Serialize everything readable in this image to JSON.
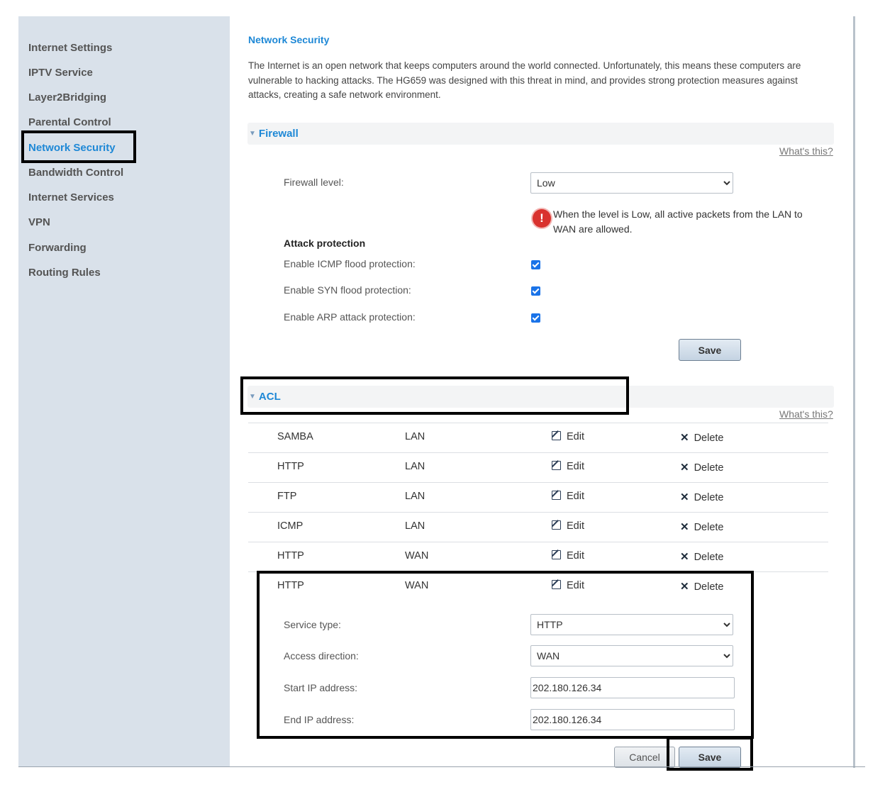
{
  "sidebar": {
    "items": [
      {
        "label": "Internet Settings"
      },
      {
        "label": "IPTV Service"
      },
      {
        "label": "Layer2Bridging"
      },
      {
        "label": "Parental Control"
      },
      {
        "label": "Network Security"
      },
      {
        "label": "Bandwidth Control"
      },
      {
        "label": "Internet Services"
      },
      {
        "label": "VPN"
      },
      {
        "label": "Forwarding"
      },
      {
        "label": "Routing Rules"
      }
    ],
    "active": "Network Security"
  },
  "main": {
    "title": "Network Security",
    "intro": "The Internet is an open network that keeps computers around the world connected. Unfortunately, this means these computers are vulnerable to hacking attacks. The HG659 was designed with this threat in mind, and provides strong protection measures against attacks, creating a safe network environment."
  },
  "firewall": {
    "section_title": "Firewall",
    "whats_this": "What's this?",
    "level_label": "Firewall level:",
    "level_value": "Low",
    "level_options": [
      "Low"
    ],
    "warning": "When the level is Low, all active packets from the LAN to WAN are allowed.",
    "attack_title": "Attack protection",
    "icmp_label": "Enable ICMP flood protection:",
    "syn_label": "Enable SYN flood protection:",
    "arp_label": "Enable ARP attack protection:",
    "icmp_checked": true,
    "syn_checked": true,
    "arp_checked": true,
    "save_label": "Save"
  },
  "acl": {
    "section_title": "ACL",
    "whats_this": "What's this?",
    "edit_label": "Edit",
    "delete_label": "Delete",
    "rows": [
      {
        "service": "SAMBA",
        "direction": "LAN"
      },
      {
        "service": "HTTP",
        "direction": "LAN"
      },
      {
        "service": "FTP",
        "direction": "LAN"
      },
      {
        "service": "ICMP",
        "direction": "LAN"
      },
      {
        "service": "HTTP",
        "direction": "WAN"
      },
      {
        "service": "HTTP",
        "direction": "WAN"
      }
    ],
    "form": {
      "service_type_label": "Service type:",
      "service_type_value": "HTTP",
      "access_direction_label": "Access direction:",
      "access_direction_value": "WAN",
      "start_ip_label": "Start IP address:",
      "start_ip_value": "202.180.126.34",
      "end_ip_label": "End IP address:",
      "end_ip_value": "202.180.126.34",
      "cancel_label": "Cancel",
      "save_label": "Save"
    }
  }
}
